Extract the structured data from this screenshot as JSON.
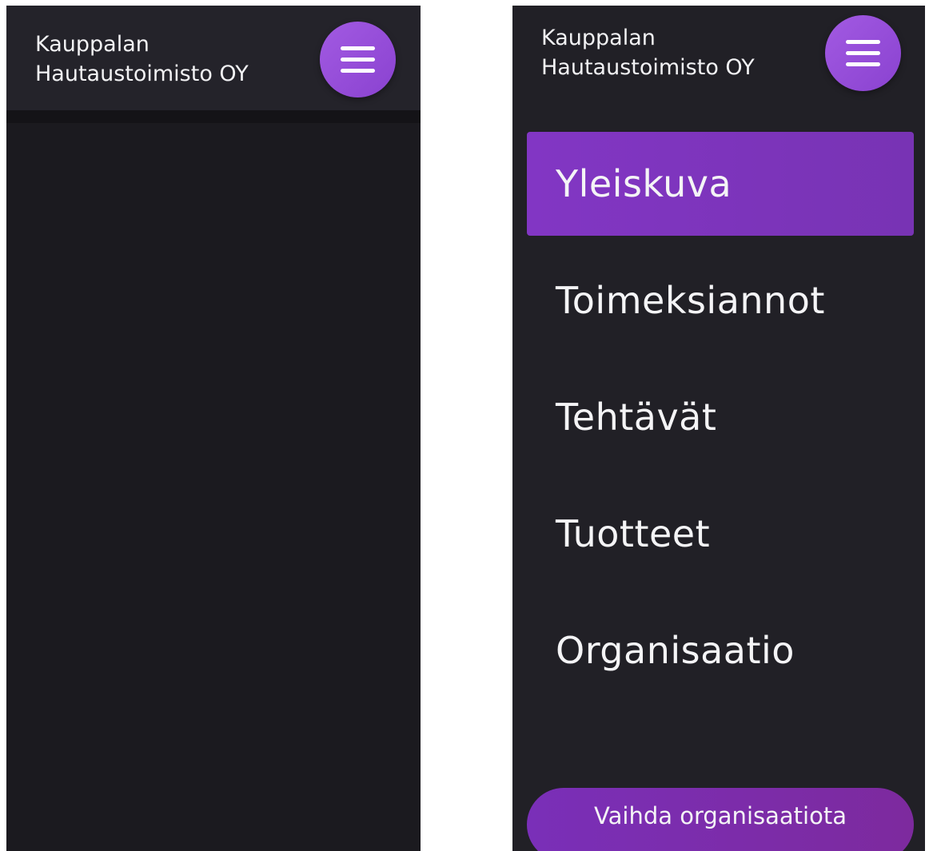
{
  "screen_closed": {
    "brand_name": "Kauppalan Hautaustoimisto OY",
    "menu_button_icon": "hamburger-icon"
  },
  "screen_open": {
    "brand_name": "Kauppalan Hautaustoimisto OY",
    "menu_button_icon": "hamburger-icon",
    "nav": {
      "items": [
        {
          "label": "Yleiskuva",
          "active": true
        },
        {
          "label": "Toimeksiannot",
          "active": false
        },
        {
          "label": "Tehtävät",
          "active": false
        },
        {
          "label": "Tuotteet",
          "active": false
        },
        {
          "label": "Organisaatio",
          "active": false
        }
      ]
    },
    "switch_org_label": "Vaihda organisaatiota"
  },
  "colors": {
    "accent": "#9a52dc",
    "active_nav": "#7f35c0",
    "background_dark": "#1b1a1f",
    "panel_dark": "#212026",
    "text": "#f2f2f4"
  }
}
